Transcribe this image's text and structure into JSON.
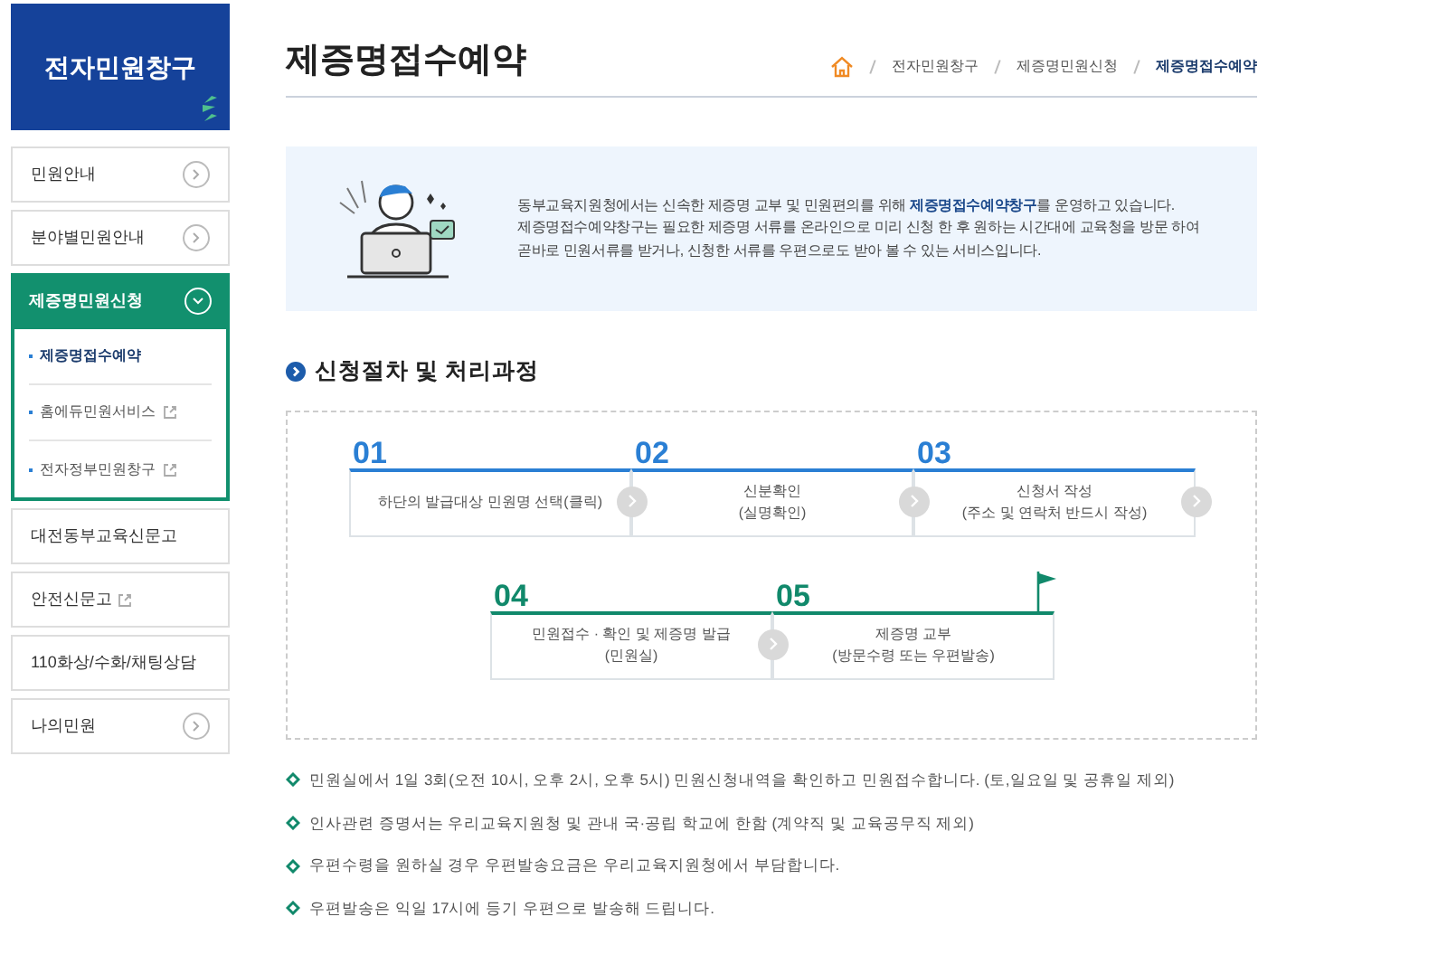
{
  "sidebar": {
    "title": "전자민원창구",
    "items": [
      {
        "label": "민원안내",
        "kind": "arrow"
      },
      {
        "label": "분야별민원안내",
        "kind": "arrow"
      },
      {
        "label": "제증명민원신청",
        "kind": "expand",
        "expanded": true,
        "children": [
          {
            "label": "제증명접수예약",
            "selected": true,
            "external": false
          },
          {
            "label": "홈에듀민원서비스",
            "selected": false,
            "external": true
          },
          {
            "label": "전자정부민원창구",
            "selected": false,
            "external": true
          }
        ]
      },
      {
        "label": "대전동부교육신문고",
        "kind": "plain"
      },
      {
        "label": "안전신문고",
        "kind": "external"
      },
      {
        "label": "110화상/수화/채팅상담",
        "kind": "plain"
      },
      {
        "label": "나의민원",
        "kind": "arrow"
      }
    ]
  },
  "page_title": "제증명접수예약",
  "breadcrumb": [
    "전자민원창구",
    "제증명민원신청",
    "제증명접수예약"
  ],
  "intro": [
    "동부교육지원청에서는 신속한 제증명 교부 및 민원편의를 위해 **제증명접수예약창구**를 운영하고 있습니다.",
    "제증명접수예약창구는 필요한 제증명 서류를 온라인으로 미리 신청 한 후 원하는 시간대에 교육청을 방문 하여",
    "곧바로 민원서류를 받거나, 신청한 서류를 우편으로도 받아 볼 수 있는 서비스입니다."
  ],
  "section_title": "신청절차 및 처리과정",
  "steps": [
    {
      "number": "01",
      "text": "하단의 발급대상 민원명 선택(클릭)",
      "color": "#2a7fd4"
    },
    {
      "number": "02",
      "text": "신분확인\n(실명확인)",
      "color": "#2a7fd4"
    },
    {
      "number": "03",
      "text": "신청서 작성\n(주소 및 연락처 반드시 작성)",
      "color": "#2a7fd4"
    },
    {
      "number": "04",
      "text": "민원접수 · 확인 및 제증명 발급\n(민원실)",
      "color": "#11896b"
    },
    {
      "number": "05",
      "text": "제증명 교부\n(방문수령 또는 우편발송)",
      "color": "#11896b"
    }
  ],
  "notes": [
    "민원실에서 1일 3회(오전 10시, 오후 2시, 오후 5시) 민원신청내역을 확인하고 민원접수합니다. (토,일요일 및 공휴일 제외)",
    "인사관련 증명서는 우리교육지원청 및 관내 국·공립 학교에 한함 (계약직 및 교육공무직 제외)",
    "우편수령을 원하실 경우 우편발송요금은 우리교육지원청에서 부담합니다.",
    "우편발송은 익일 17시에 등기 우편으로 발송해 드립니다."
  ]
}
